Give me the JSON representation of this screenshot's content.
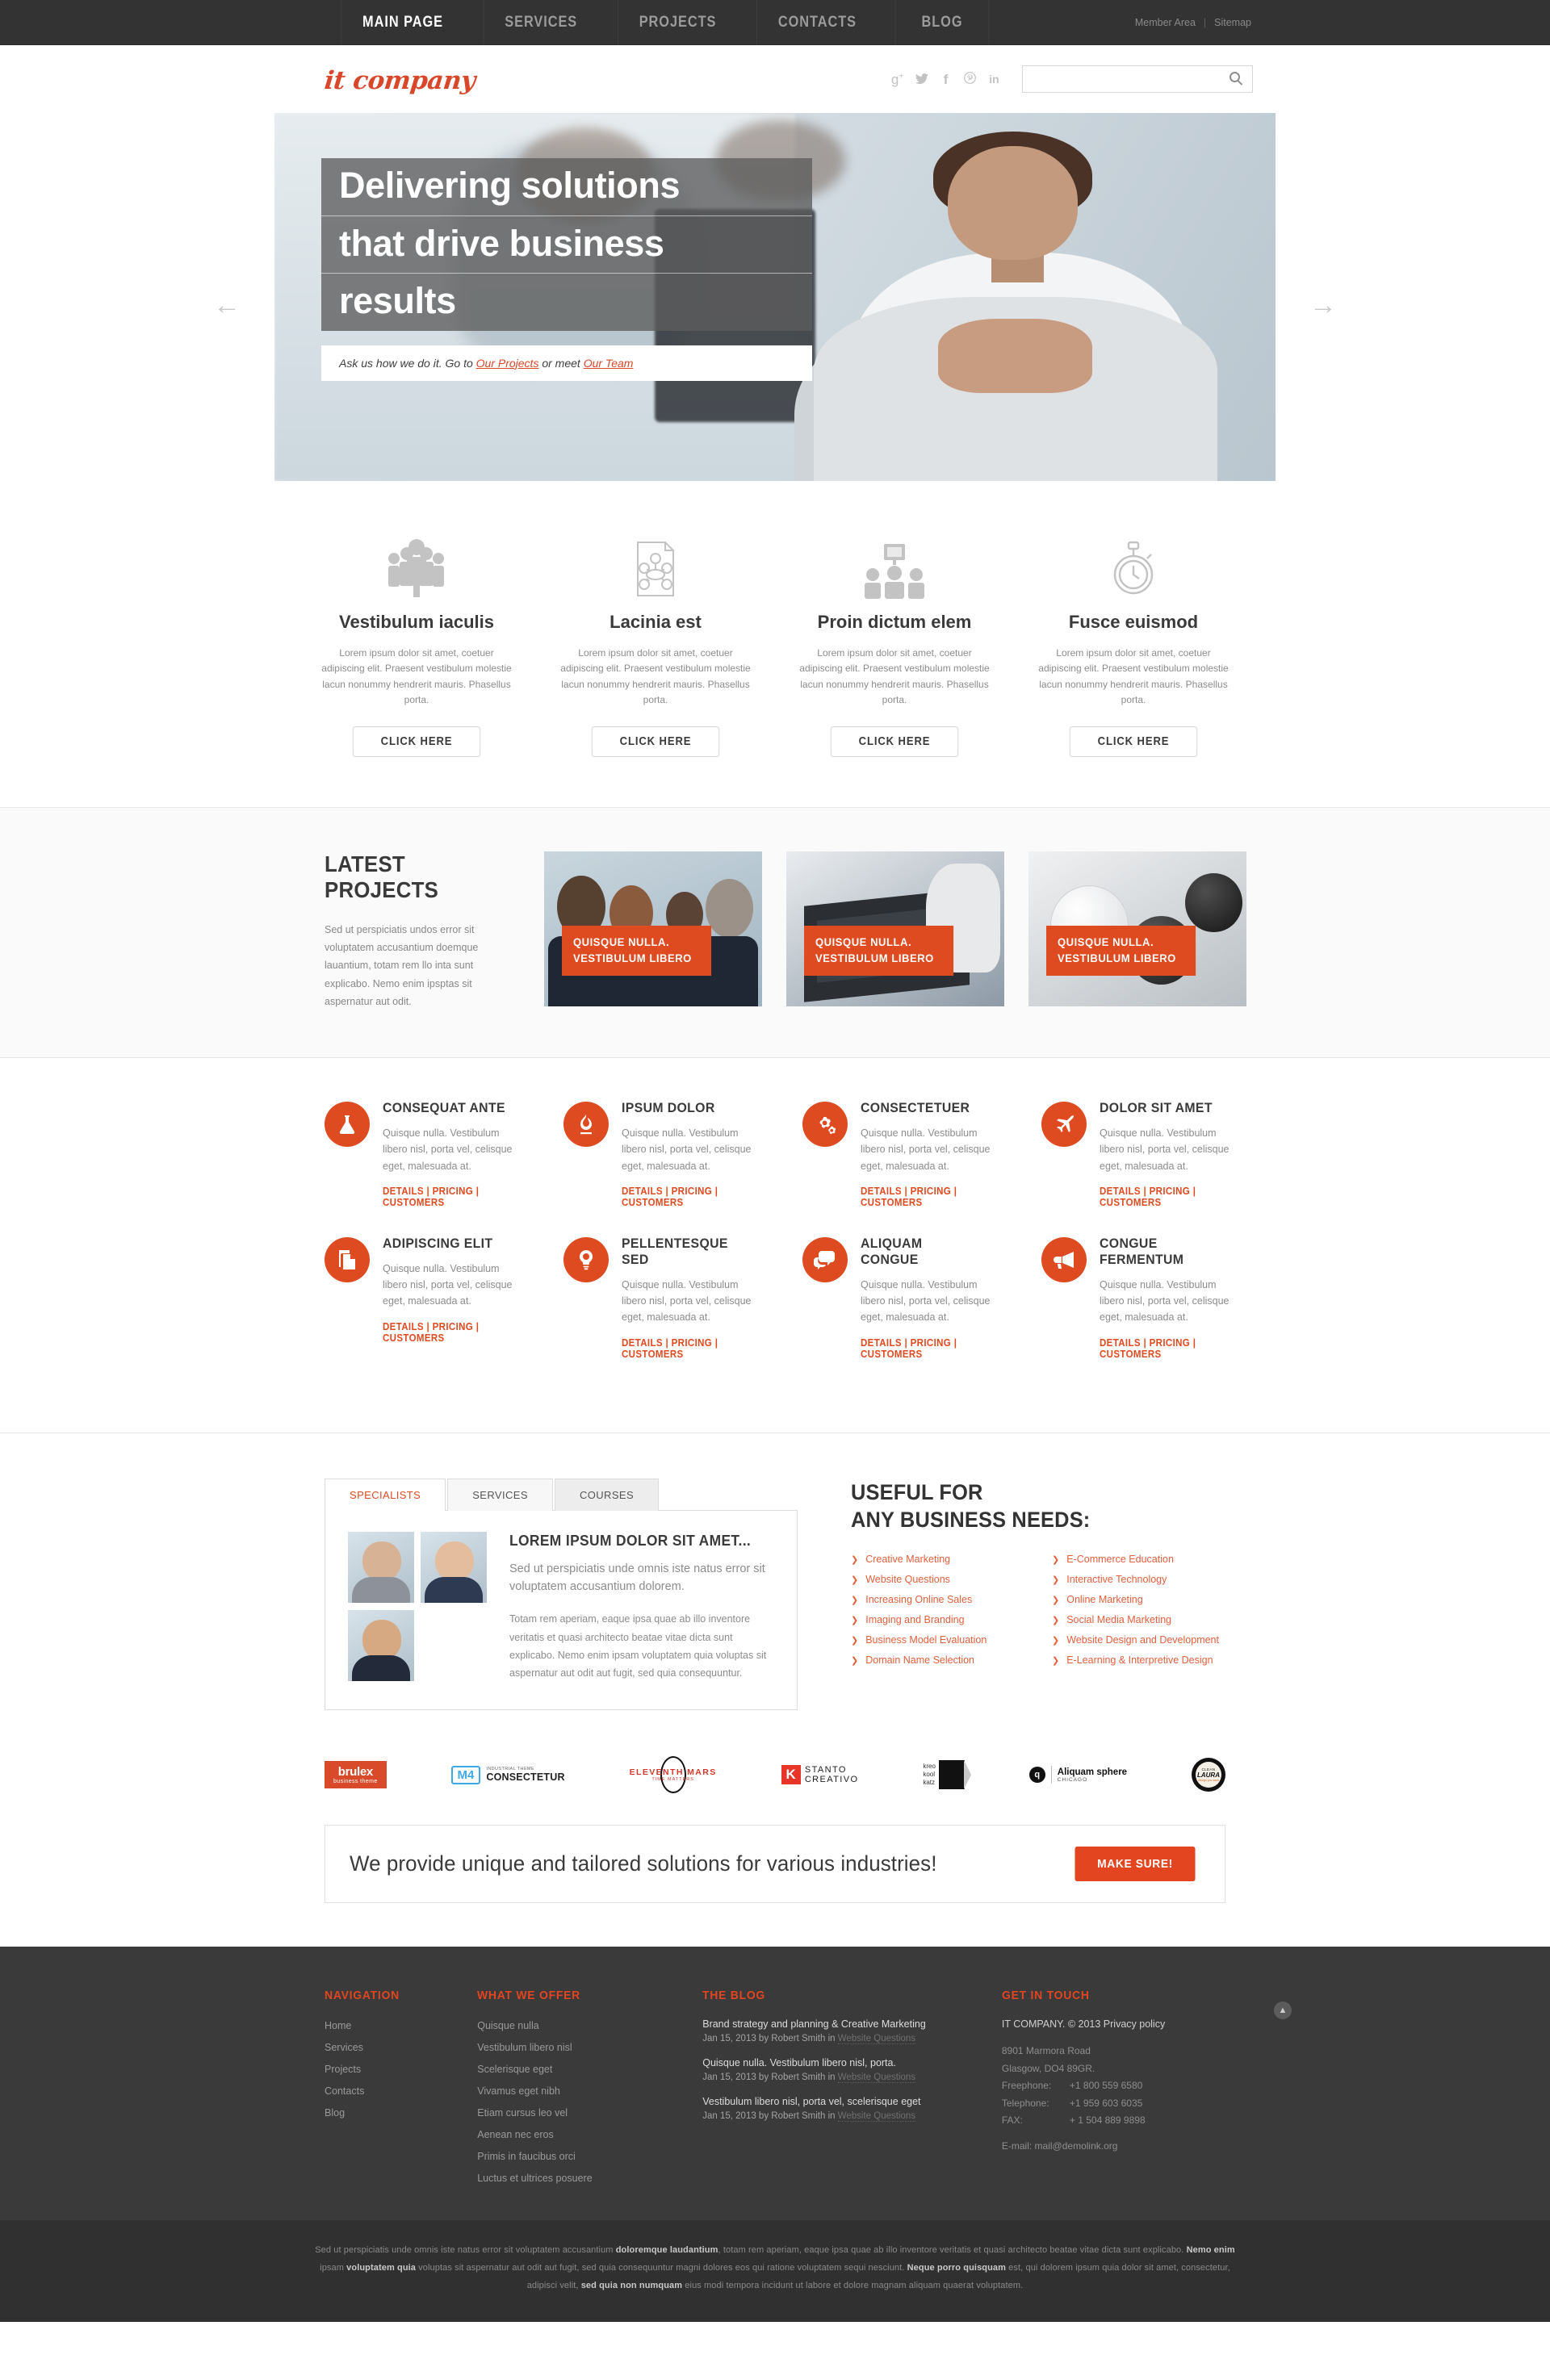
{
  "topbar": {
    "nav": [
      {
        "label": "MAIN PAGE",
        "active": true
      },
      {
        "label": "SERVICES",
        "active": false
      },
      {
        "label": "PROJECTS",
        "active": false
      },
      {
        "label": "CONTACTS",
        "active": false
      },
      {
        "label": "BLOG",
        "active": false
      }
    ],
    "member_area": "Member Area",
    "separator": "|",
    "sitemap": "Sitemap"
  },
  "header": {
    "logo": "it company",
    "socials": [
      {
        "name": "google-plus-icon",
        "glyph": "g+"
      },
      {
        "name": "twitter-icon",
        "glyph": "ᴠ"
      },
      {
        "name": "facebook-icon",
        "glyph": "f"
      },
      {
        "name": "pinterest-icon",
        "glyph": "Ⓟ"
      },
      {
        "name": "linkedin-icon",
        "glyph": "in"
      }
    ],
    "search_value": "",
    "search_placeholder": ""
  },
  "hero": {
    "line1": "Delivering solutions",
    "line2": "that drive business",
    "line3": "results",
    "sub_prefix": "Ask us how we do it. Go to",
    "sub_link1": "Our Projects",
    "sub_mid": "or meet",
    "sub_link2": "Our Team",
    "arrow_left": "←",
    "arrow_right": "→"
  },
  "features": {
    "button_label": "CLICK HERE",
    "items": [
      {
        "icon": "team-people-icon",
        "title": "Vestibulum iaculis",
        "text": "Lorem ipsum dolor sit amet, coetuer adipiscing elit. Praesent vestibulum molestie lacun nonummy hendrerit mauris. Phasellus porta."
      },
      {
        "icon": "document-diagram-icon",
        "title": "Lacinia est",
        "text": "Lorem ipsum dolor sit amet, coetuer adipiscing elit. Praesent vestibulum molestie lacun nonummy hendrerit mauris. Phasellus porta."
      },
      {
        "icon": "presentation-group-icon",
        "title": "Proin dictum elem",
        "text": "Lorem ipsum dolor sit amet, coetuer adipiscing elit. Praesent vestibulum molestie lacun nonummy hendrerit mauris. Phasellus porta."
      },
      {
        "icon": "stopwatch-icon",
        "title": "Fusce euismod",
        "text": "Lorem ipsum dolor sit amet, coetuer adipiscing elit. Praesent vestibulum molestie lacun nonummy hendrerit mauris. Phasellus porta."
      }
    ]
  },
  "projects": {
    "heading": "LATEST PROJECTS",
    "text": "Sed ut perspiciatis undos error sit voluptatem accusantium doemque lauantium, totam rem llo inta sunt explicabo. Nemo enim ipsptas sit aspernatur aut odit.",
    "cards": [
      {
        "line1": "QUISQUE NULLA.",
        "line2": "VESTIBULUM LIBERO",
        "image": "business-team-photo"
      },
      {
        "line1": "QUISQUE NULLA.",
        "line2": "VESTIBULUM LIBERO",
        "image": "laptop-keyboard-photo"
      },
      {
        "line1": "QUISQUE NULLA.",
        "line2": "VESTIBULUM LIBERO",
        "image": "billiard-balls-photo"
      }
    ]
  },
  "services": {
    "links_label": "DETAILS | PRICING | CUSTOMERS",
    "body": "Quisque nulla. Vestibulum libero nisl, porta vel, celisque eget, malesuada at.",
    "items": [
      {
        "icon": "flask-icon",
        "title": "CONSEQUAT ANTE"
      },
      {
        "icon": "flame-icon",
        "title": "IPSUM DOLOR"
      },
      {
        "icon": "gears-icon",
        "title": "CONSECTETUER"
      },
      {
        "icon": "airplane-icon",
        "title": "DOLOR SIT AMET"
      },
      {
        "icon": "documents-icon",
        "title": "ADIPISCING ELIT"
      },
      {
        "icon": "lightbulb-icon",
        "title": "PELLENTESQUE SED"
      },
      {
        "icon": "speech-bubble-icon",
        "title": "ALIQUAM CONGUE"
      },
      {
        "icon": "megaphone-icon",
        "title": "CONGUE FERMENTUM"
      }
    ]
  },
  "tabs": {
    "items": [
      {
        "label": "SPECIALISTS",
        "active": true
      },
      {
        "label": "SERVICES",
        "active": false
      },
      {
        "label": "COURSES",
        "active": false
      }
    ],
    "panel": {
      "heading": "LOREM IPSUM DOLOR SIT AMET...",
      "lead": "Sed ut perspiciatis unde omnis iste natus error sit voluptatem accusantium dolorem.",
      "body": "Totam rem aperiam, eaque ipsa quae ab illo inventore veritatis et quasi architecto beatae vitae dicta sunt explicabo. Nemo enim ipsam voluptatem quia voluptas sit aspernatur aut odit aut fugit, sed quia consequuntur.",
      "thumbs": [
        {
          "name": "specialist-photo-1"
        },
        {
          "name": "specialist-photo-2"
        },
        {
          "name": "specialist-photo-3"
        }
      ]
    }
  },
  "useful": {
    "title_line1": "USEFUL FOR",
    "title_line2": "ANY BUSINESS NEEDS:",
    "col_left": [
      "Creative Marketing",
      "Website Questions",
      "Increasing Online Sales",
      "Imaging and Branding",
      "Business Model Evaluation",
      "Domain Name Selection"
    ],
    "col_right": [
      "E-Commerce Education",
      "Interactive Technology",
      "Online Marketing",
      "Social Media Marketing",
      "Website Design and Development",
      "E-Learning & Interpretive Design"
    ]
  },
  "partners": [
    {
      "name": "brulex-logo",
      "main": "brulex",
      "sub": "business theme"
    },
    {
      "name": "m4-consectetur-logo",
      "badge": "M4",
      "main": "CONSECTETUR",
      "sub": "INDUSTRIAL THEME"
    },
    {
      "name": "eleventh-mars-logo",
      "main": "ELEVENTH MARS",
      "sub": "TIME MATTERS"
    },
    {
      "name": "stanto-creativo-logo",
      "badge": "K",
      "main": "STANTO",
      "sub": "CREATIVO"
    },
    {
      "name": "kreo-kool-katz-logo",
      "main": "kreo kool katz"
    },
    {
      "name": "aliquam-sphere-logo",
      "badge": "q",
      "main": "Aliquam sphere",
      "sub": "CHICAGO"
    },
    {
      "name": "clean-laura-logo",
      "main": "LAURA",
      "sub": "CLEAN"
    }
  ],
  "cta": {
    "text": "We provide unique and tailored solutions for various industries!",
    "button": "MAKE SURE!"
  },
  "footer": {
    "nav_title": "NAVIGATION",
    "nav_items": [
      "Home",
      "Services",
      "Projects",
      "Contacts",
      "Blog"
    ],
    "offer_title": "WHAT WE OFFER",
    "offer_items": [
      "Quisque nulla",
      "Vestibulum libero nisl",
      "Scelerisque eget",
      "Vivamus eget nibh",
      "Etiam cursus leo vel",
      "Aenean nec eros",
      "Primis in faucibus orci",
      "Luctus et ultrices posuere"
    ],
    "blog_title": "THE BLOG",
    "blog_posts": [
      {
        "title": "Brand strategy and planning & Creative Marketing",
        "meta_prefix": "Jan 15, 2013 by Robert Smith in",
        "meta_link": "Website Questions"
      },
      {
        "title": "Quisque nulla. Vestibulum libero nisl, porta.",
        "meta_prefix": "Jan 15, 2013 by Robert Smith in",
        "meta_link": "Website Questions"
      },
      {
        "title": "Vestibulum libero nisl, porta vel, scelerisque eget",
        "meta_prefix": "Jan 15, 2013 by Robert Smith in",
        "meta_link": "Website Questions"
      }
    ],
    "touch_title": "GET IN TOUCH",
    "company_line": "IT COMPANY. © 2013 Privacy policy",
    "address_line1": "8901 Marmora Road",
    "address_line2": "Glasgow, DO4 89GR.",
    "freephone_label": "Freephone:",
    "freephone_value": "+1 800 559 6580",
    "telephone_label": "Telephone:",
    "telephone_value": "+1 959 603 6035",
    "fax_label": "FAX:",
    "fax_value": "+ 1 504 889 9898",
    "email": "E-mail: mail@demolink.org",
    "to_top": "▲"
  },
  "copyright": {
    "p1_a": "Sed ut perspiciatis unde omnis iste natus error sit voluptatem accusantium ",
    "p1_b": "doloremque laudantium",
    "p1_c": ", totam rem aperiam, eaque ipsa quae ab illo inventore veritatis et quasi architecto beatae vitae dicta sunt explicabo. ",
    "p1_d": "Nemo enim",
    "p2_a": "ipsam ",
    "p2_b": "voluptatem quia",
    "p2_c": " voluptas sit aspernatur aut odit aut fugit, sed quia consequuntur magni dolores eos qui ratione voluptatem sequi nesciunt. ",
    "p2_d": "Neque porro quisquam",
    "p2_e": " est, qui dolorem ipsum quia dolor sit amet, consectetur,",
    "p3_a": "adipisci velit, ",
    "p3_b": "sed quia non numquam",
    "p3_c": " eius modi tempora incidunt ut labore et dolore magnam aliquam quaerat voluptatem."
  },
  "colors": {
    "accent": "#df4b21",
    "accent_dark": "#d9472a",
    "dark_bar": "#333333",
    "footer_bg": "#3a3a3a",
    "copy_bg": "#303030"
  }
}
